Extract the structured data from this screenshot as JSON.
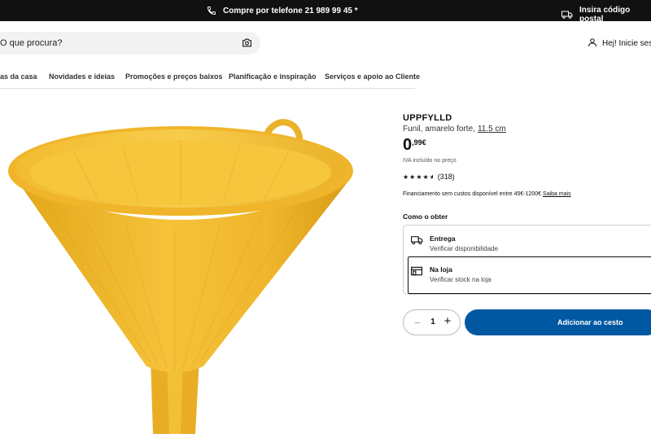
{
  "topbar": {
    "phone_text": "Compre por telefone 21 989 99 45 *",
    "postal_text": "Insira código postal"
  },
  "header": {
    "search_placeholder": "O que procura?",
    "user_text": "Hej! Inicie sessão"
  },
  "nav": {
    "items": [
      "as da casa",
      "Novidades e ideias",
      "Promoções e preços baixos",
      "Planificação e inspiração",
      "Serviços e apoio ao Cliente"
    ]
  },
  "product": {
    "name": "UPPFYLLD",
    "description": "Funil, amarelo forte,",
    "size": "11.5 cm",
    "price_int": "0",
    "price_dec": ",99€",
    "vat_note": "IVA incluído no preço",
    "rating_count": "(318)",
    "rating_value": 4.5,
    "financing_text": "Financiamento sem custos disponível entre 45€-1200€",
    "financing_link": "Saiba mais",
    "image_color": "#f2b824"
  },
  "purchase": {
    "how_to_get": "Como o obter",
    "delivery_title": "Entrega",
    "delivery_sub": "Verificar disponibilidade",
    "store_title": "Na loja",
    "store_sub": "Verificar stock na loja",
    "quantity": "1",
    "add_to_cart": "Adicionar ao cesto",
    "accent_color": "#0058a3"
  }
}
